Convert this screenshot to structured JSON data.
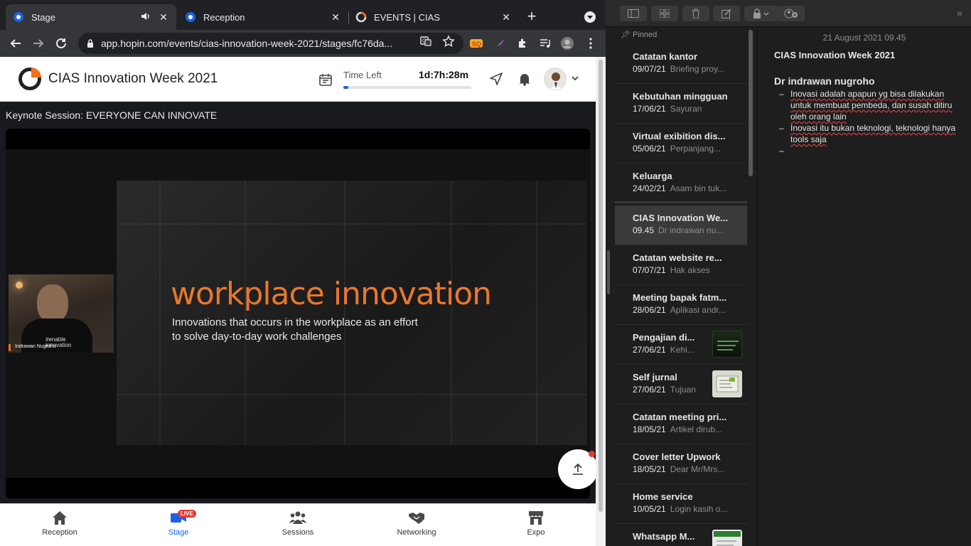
{
  "browser": {
    "tabs": [
      {
        "title": "Stage",
        "active": true,
        "audio": true
      },
      {
        "title": "Reception",
        "active": false
      },
      {
        "title": "EVENTS | CIAS",
        "active": false
      }
    ],
    "url": "app.hopin.com/events/cias-innovation-week-2021/stages/fc76da..."
  },
  "hopin": {
    "event_title": "CIAS Innovation Week 2021",
    "time_left_label": "Time Left",
    "time_left_value": "1d:7h:28m",
    "time_left_progress": 0.04,
    "session_title": "Keynote Session: EVERYONE CAN INNOVATE",
    "slide": {
      "heading": "workplace innovation",
      "subtitle_line1": "Innovations that occurs in the workplace as an effort",
      "subtitle_line2": "to solve day-to-day work challenges"
    },
    "speaker": {
      "name": "Indrawan Nugroho",
      "shirt_line1": "#enable",
      "shirt_line2": "innovation"
    },
    "bottom_nav": [
      {
        "label": "Reception",
        "icon": "home-icon"
      },
      {
        "label": "Stage",
        "icon": "camera-icon",
        "badge": "LIVE",
        "active": true
      },
      {
        "label": "Sessions",
        "icon": "people-icon"
      },
      {
        "label": "Networking",
        "icon": "handshake-icon"
      },
      {
        "label": "Expo",
        "icon": "store-icon"
      }
    ],
    "accent_color": "#1d62e6",
    "brand_orange": "#f37021"
  },
  "notes": {
    "pinned_label": "Pinned",
    "items": [
      {
        "title": "Catatan kantor",
        "date": "09/07/21",
        "preview": "Briefing proy..."
      },
      {
        "title": "Kebutuhan mingguan",
        "date": "17/06/21",
        "preview": "Sayuran"
      },
      {
        "title": "Virtual exibition dis...",
        "date": "05/06/21",
        "preview": "Perpanjang..."
      },
      {
        "title": "Keluarga",
        "date": "24/02/21",
        "preview": "Asam bin tuk..."
      },
      {
        "title": "CIAS Innovation We...",
        "date": "09.45",
        "preview": "Dr indrawan nu...",
        "selected": true
      },
      {
        "title": "Catatan website re...",
        "date": "07/07/21",
        "preview": "Hak akses"
      },
      {
        "title": "Meeting bapak fatm...",
        "date": "28/06/21",
        "preview": "Aplikasi andr..."
      },
      {
        "title": "Pengajian di...",
        "date": "27/06/21",
        "preview": "Kehi...",
        "thumb": "dark"
      },
      {
        "title": "Self jurnal",
        "date": "27/06/21",
        "preview": "Tujuan",
        "thumb": "light"
      },
      {
        "title": "Catatan meeting pri...",
        "date": "18/05/21",
        "preview": "Artikel dirub..."
      },
      {
        "title": "Cover letter Upwork",
        "date": "18/05/21",
        "preview": "Dear Mr/Mrs..."
      },
      {
        "title": "Home service",
        "date": "10/05/21",
        "preview": "Login kasih o..."
      },
      {
        "title": "Whatsapp M...",
        "date": "",
        "preview": "",
        "thumb": "mixed"
      }
    ],
    "editor": {
      "date": "21 August 2021 09.45",
      "title": "CIAS Innovation Week 2021",
      "heading": "Dr indrawan nugroho",
      "bullets": [
        "Inovasi adalah apapun yg bisa dilakukan untuk membuat pembeda, dan susah ditiru oleh orang lain",
        "Inovasi itu bukan teknologi, teknologi hanya tools saja",
        ""
      ]
    }
  }
}
